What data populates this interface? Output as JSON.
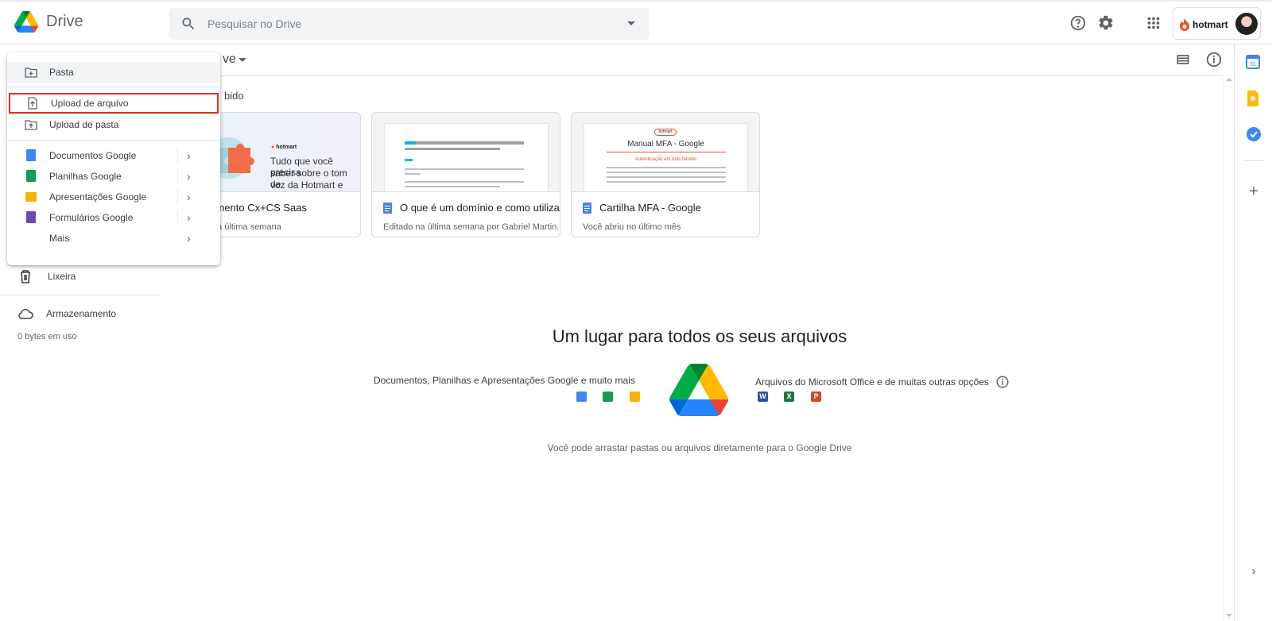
{
  "app": {
    "title": "Drive"
  },
  "search": {
    "placeholder": "Pesquisar no Drive"
  },
  "account": {
    "brand": "hotmart"
  },
  "subheader": {
    "breadcrumb_fragment": "ve"
  },
  "section": {
    "label_fragment": "bido"
  },
  "cards": [
    {
      "title": "namento Cx+CS Saas",
      "subtitle": "na última semana",
      "thumb_text": [
        "Tudo que você precisa",
        "saber sobre o tom de",
        "voz da Hotmart e"
      ]
    },
    {
      "title": "O que é um domínio e como utiliza-l...",
      "subtitle": "Editado na última semana por Gabriel Martin..."
    },
    {
      "title": "Cartilha MFA - Google",
      "subtitle": "Você abriu no último mês",
      "thumb_text": [
        "Manual MFA - Google",
        "Autenticação em dois fatores"
      ]
    }
  ],
  "empty_state": {
    "title": "Um lugar para todos os seus arquivos",
    "left_text": "Documentos, Planilhas e Apresentações Google e muito mais",
    "right_text": "Arquivos do Microsoft Office e de muitas outras opções",
    "drag_text": "Você pode arrastar pastas ou arquivos diretamente para o Google Drive"
  },
  "sidebar": {
    "trash": "Lixeira",
    "storage": "Armazenamento",
    "usage": "0 bytes em uso"
  },
  "menu": {
    "items": [
      {
        "label": "Pasta",
        "icon": "new-folder-icon"
      },
      {
        "label": "Upload de arquivo",
        "icon": "file-upload-icon"
      },
      {
        "label": "Upload de pasta",
        "icon": "folder-upload-icon"
      },
      {
        "label": "Documentos Google",
        "icon": "google-docs-icon"
      },
      {
        "label": "Planilhas Google",
        "icon": "google-sheets-icon"
      },
      {
        "label": "Apresentações Google",
        "icon": "google-slides-icon"
      },
      {
        "label": "Formulários Google",
        "icon": "google-forms-icon"
      },
      {
        "label": "Mais",
        "icon": ""
      }
    ]
  },
  "colors": {
    "docs": "#4285f4",
    "sheets": "#0f9d58",
    "slides": "#f4b400",
    "forms": "#7248b9",
    "highlight": "#d93025"
  }
}
